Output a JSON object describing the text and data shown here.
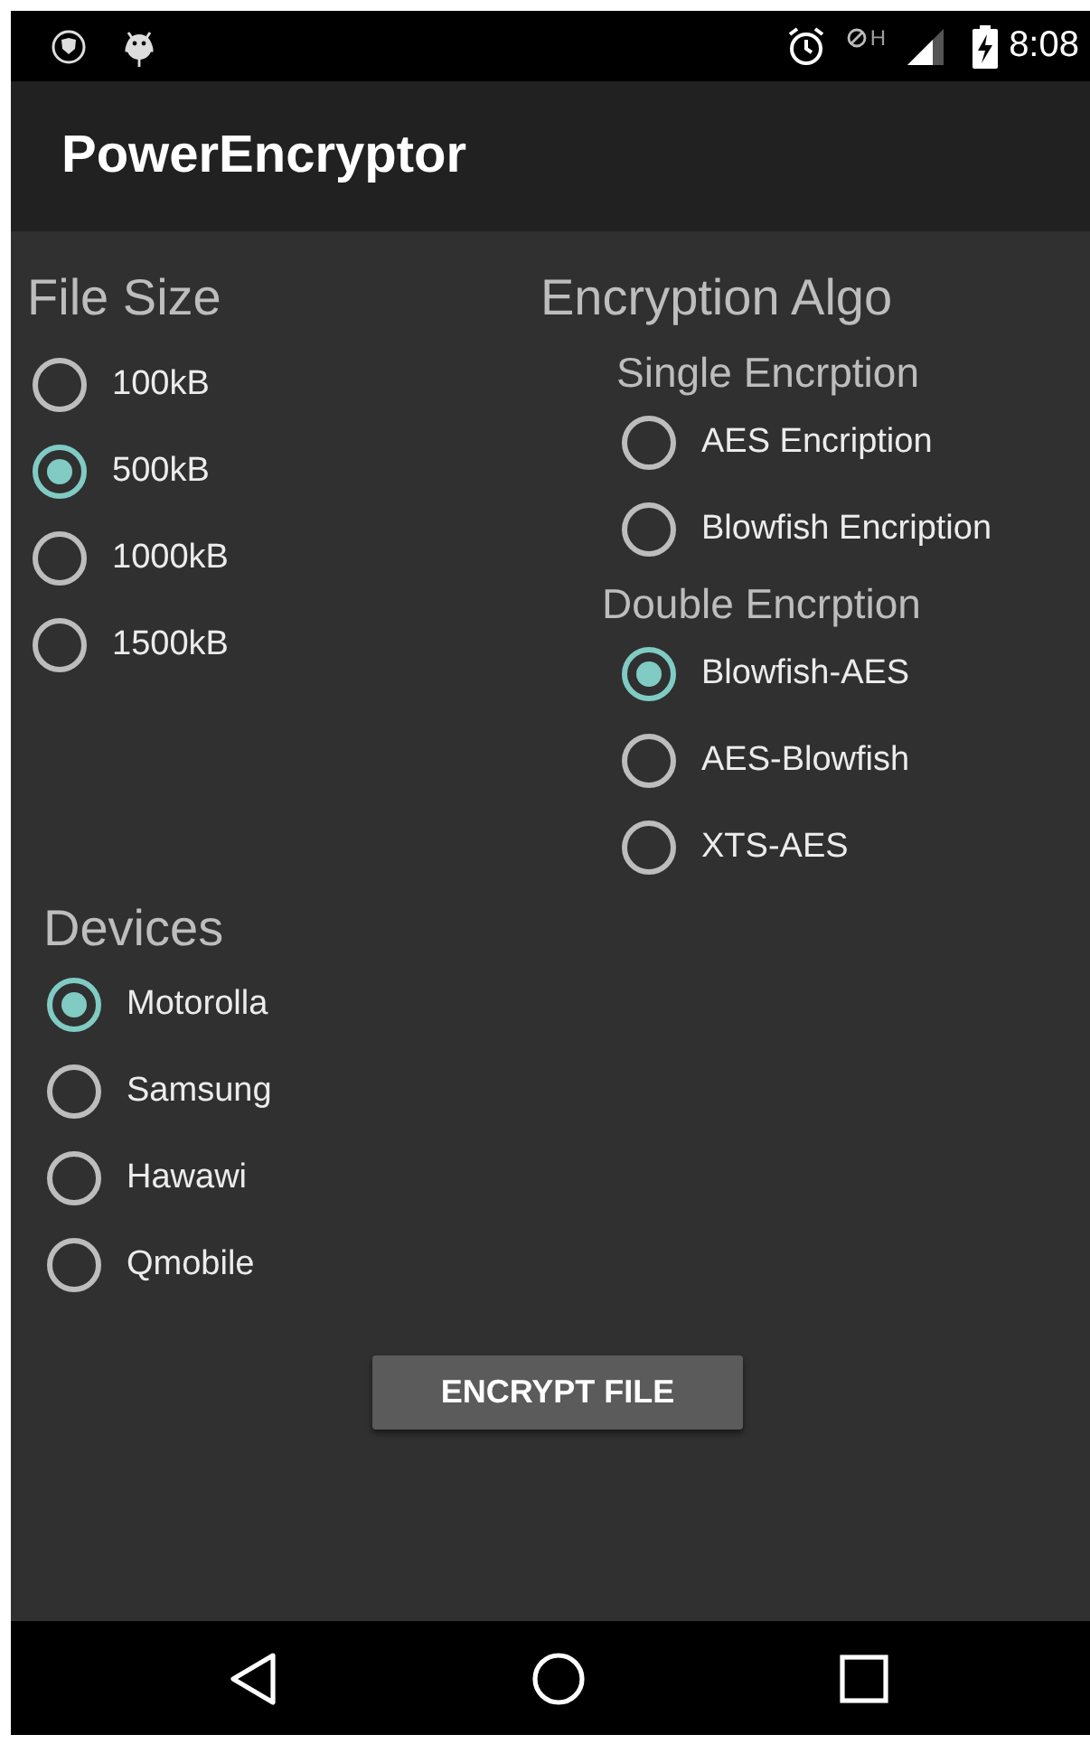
{
  "status_bar": {
    "network_type": "H",
    "time": "8:08"
  },
  "app_bar": {
    "title": "PowerEncryptor"
  },
  "file_size": {
    "title": "File Size",
    "options": [
      {
        "label": "100kB",
        "selected": false
      },
      {
        "label": "500kB",
        "selected": true
      },
      {
        "label": "1000kB",
        "selected": false
      },
      {
        "label": "1500kB",
        "selected": false
      }
    ]
  },
  "encryption_algo": {
    "title": "Encryption Algo",
    "groups": [
      {
        "title": "Single Encrption",
        "options": [
          {
            "label": "AES Encription",
            "selected": false
          },
          {
            "label": "Blowfish Encription",
            "selected": false
          }
        ]
      },
      {
        "title": "Double Encrption",
        "options": [
          {
            "label": "Blowfish-AES",
            "selected": true
          },
          {
            "label": "AES-Blowfish",
            "selected": false
          },
          {
            "label": "XTS-AES",
            "selected": false
          }
        ]
      }
    ]
  },
  "devices": {
    "title": "Devices",
    "options": [
      {
        "label": "Motorolla",
        "selected": true
      },
      {
        "label": "Samsung",
        "selected": false
      },
      {
        "label": "Hawawi",
        "selected": false
      },
      {
        "label": "Qmobile",
        "selected": false
      }
    ]
  },
  "button": {
    "label": "ENCRYPT FILE"
  }
}
